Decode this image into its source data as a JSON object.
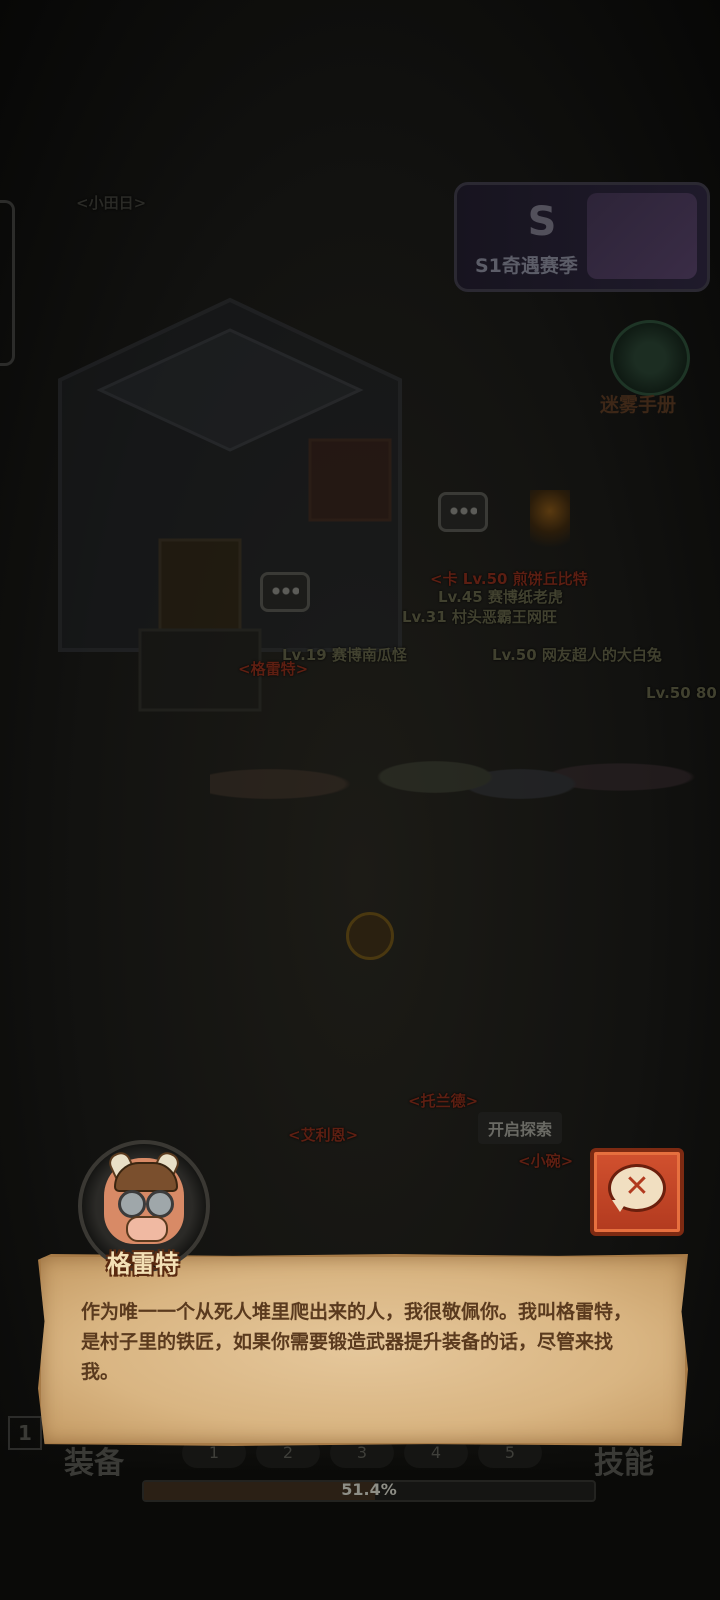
{
  "season": {
    "label": "S1奇遇赛季",
    "s_glyph": "S"
  },
  "fog_handbook": {
    "label": "迷雾手册"
  },
  "world": {
    "npc_names": [
      "<小田日>",
      "<格雷特>",
      "<托兰德>",
      "<艾利恩>",
      "<小碗>"
    ],
    "player_labels": [
      "<卡 Lv.50 煎饼丘比特",
      "Lv.45 赛博纸老虎",
      "Lv.31 村头恶霸王网旺",
      "Lv.19 赛博南瓜怪",
      "Lv.50 网友超人的大白兔",
      "Lv.50 80"
    ],
    "tip": "开启探索"
  },
  "dialog": {
    "speaker": "格雷特",
    "text": "作为唯一一个从死人堆里爬出来的人，我很敬佩你。我叫格雷特，是村子里的铁匠，如果你需要锻造武器提升装备的话，尽管来找我。"
  },
  "close_button": {
    "icon": "close-chat-icon"
  },
  "bottom": {
    "level": "1",
    "equip_label": "装备",
    "skill_label": "技能",
    "slots": [
      "1",
      "2",
      "3",
      "4",
      "5"
    ],
    "progress_text": "51.4%",
    "progress_value": 0.514
  },
  "colors": {
    "dialog_bg": "#d9b582",
    "dialog_text": "#5a3a1e",
    "close_button": "#c4472a",
    "name_plate": "#f3e0b5"
  }
}
